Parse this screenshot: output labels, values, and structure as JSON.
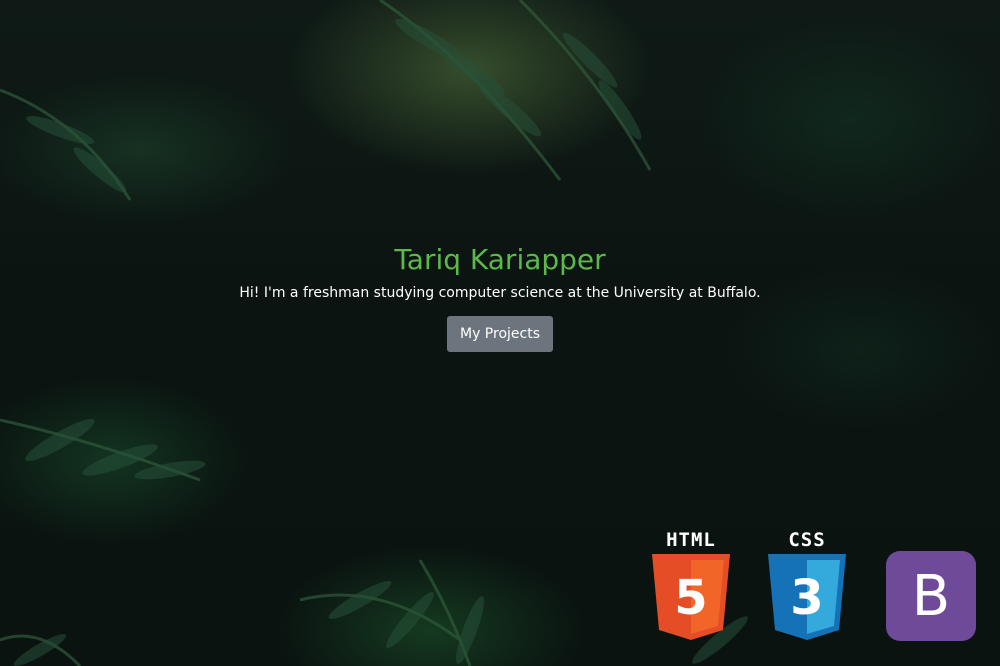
{
  "hero": {
    "name": "Tariq Kariapper",
    "tagline": "Hi! I'm a freshman studying computer science at the University at Buffalo.",
    "cta_label": "My Projects"
  },
  "tech_logos": {
    "html5": {
      "caption": "HTML",
      "glyph": "5",
      "color": "#e44d26"
    },
    "css3": {
      "caption": "CSS",
      "glyph": "3",
      "color": "#1572b6"
    },
    "bootstrap": {
      "glyph": "B",
      "color": "#6f4a98"
    }
  },
  "colors": {
    "name": "#5db84b",
    "button": "#6c757d",
    "background": "#0b1411"
  }
}
